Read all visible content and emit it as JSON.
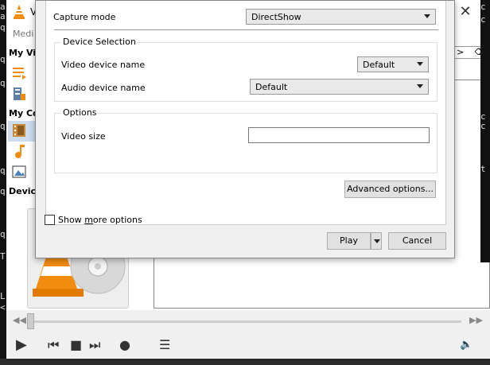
{
  "vlc": {
    "title": "V",
    "menu": "Medi",
    "sidebar": {
      "h1": "My Vi",
      "h2": "My Co",
      "h3": "Device"
    },
    "search_text": ">"
  },
  "dialog": {
    "capture_mode_label": "Capture mode",
    "capture_mode_value": "DirectShow",
    "device_selection": {
      "title": "Device Selection",
      "video_label": "Video device name",
      "video_value": "Default",
      "audio_label": "Audio device name",
      "audio_value": "Default"
    },
    "options": {
      "title": "Options",
      "video_size_label": "Video size",
      "video_size_value": ""
    },
    "advanced_button": "Advanced options...",
    "show_more_prefix": "Show ",
    "show_more_underlined": "m",
    "show_more_suffix": "ore options",
    "play_button": "Play",
    "cancel_button": "Cancel"
  },
  "colors": {
    "vlc_orange": "#f28c0f",
    "dialog_bg": "#f0f0f0"
  }
}
